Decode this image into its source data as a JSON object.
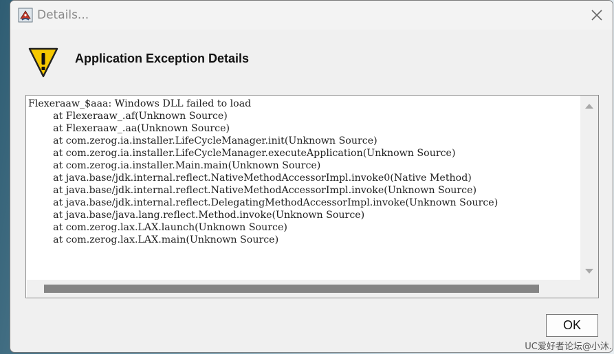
{
  "window": {
    "title": "Details...",
    "close_icon": "close-x-icon",
    "app_icon": "java-installer-icon"
  },
  "dialog": {
    "heading": "Application Exception Details",
    "warning_icon": "warning-triangle-icon",
    "details_lines": [
      "Flexeraaw_$aaa: Windows DLL failed to load",
      "        at Flexeraaw_.af(Unknown Source)",
      "        at Flexeraaw_.aa(Unknown Source)",
      "        at com.zerog.ia.installer.LifeCycleManager.init(Unknown Source)",
      "        at com.zerog.ia.installer.LifeCycleManager.executeApplication(Unknown Source)",
      "        at com.zerog.ia.installer.Main.main(Unknown Source)",
      "        at java.base/jdk.internal.reflect.NativeMethodAccessorImpl.invoke0(Native Method)",
      "        at java.base/jdk.internal.reflect.NativeMethodAccessorImpl.invoke(Unknown Source)",
      "        at java.base/jdk.internal.reflect.DelegatingMethodAccessorImpl.invoke(Unknown Source)",
      "        at java.base/java.lang.reflect.Method.invoke(Unknown Source)",
      "        at com.zerog.lax.LAX.launch(Unknown Source)",
      "        at com.zerog.lax.LAX.main(Unknown Source)"
    ],
    "ok_label": "OK"
  },
  "watermark": "UC爱好者论坛@小沐.",
  "colors": {
    "window_bg": "#f0f0f0",
    "warning_yellow": "#f5c800",
    "scroll_thumb": "#858585"
  }
}
